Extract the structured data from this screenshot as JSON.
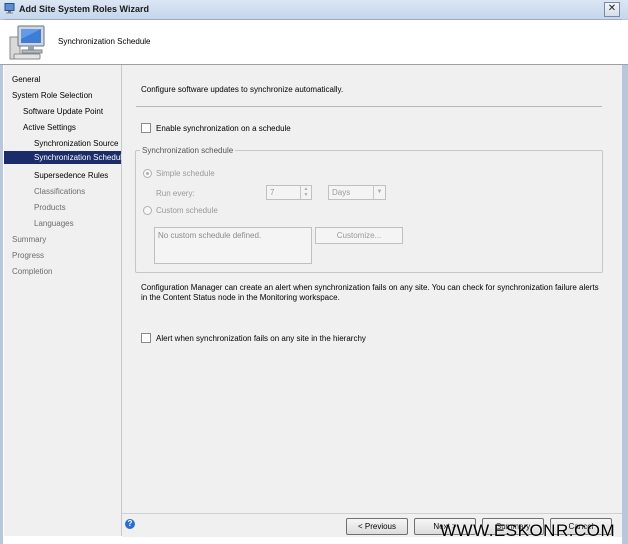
{
  "window": {
    "title": "Add Site System Roles Wizard",
    "close_glyph": "✕"
  },
  "header": {
    "title": "Synchronization Schedule"
  },
  "sidebar": {
    "items": [
      {
        "label": "General"
      },
      {
        "label": "System Role Selection"
      },
      {
        "label": "Software Update Point"
      },
      {
        "label": "Active Settings"
      },
      {
        "label": "Synchronization Source"
      },
      {
        "label": "Synchronization Schedule"
      },
      {
        "label": "Supersedence Rules"
      },
      {
        "label": "Classifications"
      },
      {
        "label": "Products"
      },
      {
        "label": "Languages"
      },
      {
        "label": "Summary"
      },
      {
        "label": "Progress"
      },
      {
        "label": "Completion"
      }
    ]
  },
  "main": {
    "intro": "Configure software updates to synchronize automatically.",
    "enable_sync_label": "Enable synchronization on a schedule",
    "enable_sync_checked": false,
    "group": {
      "legend": "Synchronization schedule",
      "simple_schedule_label": "Simple schedule",
      "run_every_label": "Run every:",
      "run_every_value": "7",
      "run_every_unit": "Days",
      "custom_schedule_label": "Custom schedule",
      "custom_schedule_text": "No custom schedule defined.",
      "customize_button": "Customize..."
    },
    "info_text": "Configuration Manager can create an alert when synchronization fails on any site. You can check for synchronization failure alerts in the Content Status node in the Monitoring workspace.",
    "alert_label": "Alert when synchronization fails on any site in the hierarchy",
    "alert_checked": false
  },
  "footer": {
    "help_glyph": "?",
    "previous_button": "< Previous",
    "next_button": "Next >",
    "summary_button": "Summary",
    "cancel_button": "Cancel"
  },
  "watermark": "WWW.ESKONR.COM"
}
